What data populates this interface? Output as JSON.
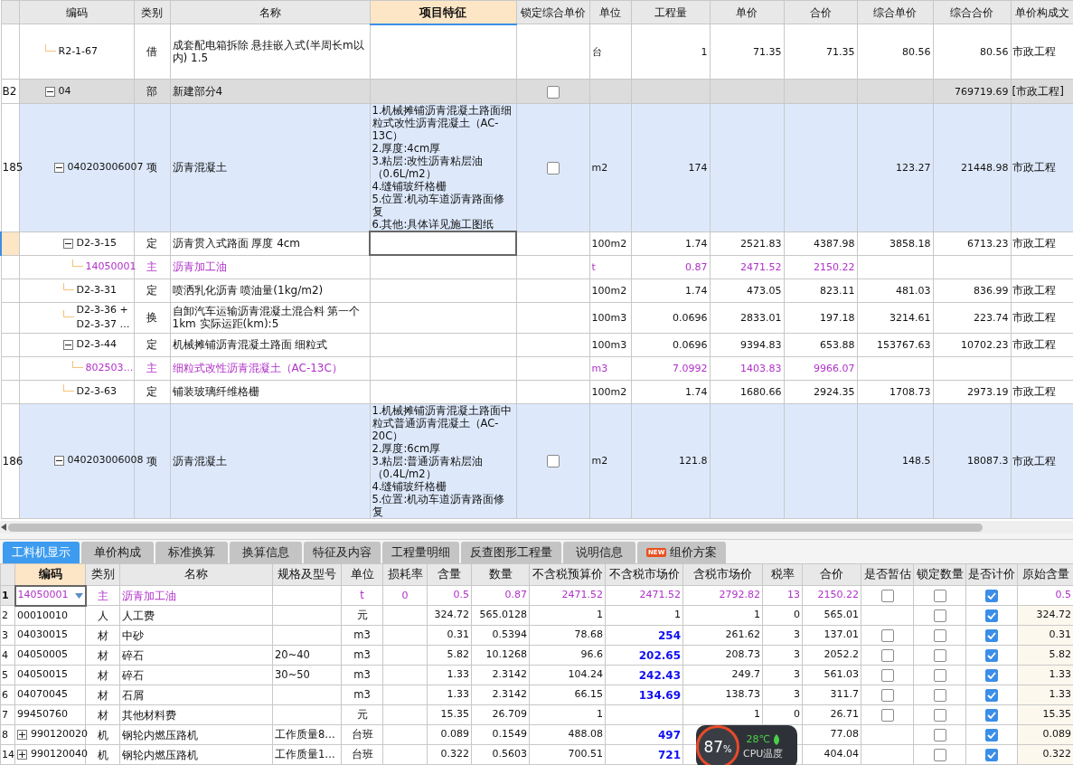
{
  "top_table": {
    "columns": [
      {
        "label": "编码",
        "selected": false
      },
      {
        "label": "类别",
        "selected": false
      },
      {
        "label": "名称",
        "selected": false
      },
      {
        "label": "项目特征",
        "selected": true
      },
      {
        "label": "锁定综合单价",
        "selected": false
      },
      {
        "label": "单位",
        "selected": false
      },
      {
        "label": "工程量",
        "selected": false
      },
      {
        "label": "单价",
        "selected": false
      },
      {
        "label": "合价",
        "selected": false
      },
      {
        "label": "综合单价",
        "selected": false
      },
      {
        "label": "综合合价",
        "selected": false
      },
      {
        "label": "单价构成文",
        "selected": false
      }
    ],
    "rows": [
      {
        "kind": "quota",
        "code": "R2-1-67",
        "type": "借",
        "name": "成套配电箱拆除 悬挂嵌入式(半周长m以内) 1.5",
        "unit": "台",
        "qty": "1",
        "price": "71.35",
        "total": "71.35",
        "unit_total": "80.56",
        "sum_total": "80.56",
        "composition": "市政工程",
        "selected": false
      },
      {
        "kind": "section",
        "num": "B2",
        "code": "04",
        "type": "部",
        "name": "新建部分4",
        "lock": false,
        "sum_total": "769719.69",
        "composition": "[市政工程]",
        "expanded": true,
        "selected": false,
        "children": [
          {
            "kind": "item",
            "num": "185",
            "code": "040203006007",
            "type": "项",
            "name": "沥青混凝土",
            "feature": "1.机械摊铺沥青混凝土路面细粒式改性沥青混凝土（AC-13C）\n2.厚度:4cm厚\n3.粘层:改性沥青粘层油（0.6L/m2）\n4.缝铺玻纤格栅\n5.位置:机动车道沥青路面修复\n6.其他:具体详见施工图纸",
            "lock": false,
            "unit": "m2",
            "qty": "174",
            "unit_total": "123.27",
            "sum_total": "21448.98",
            "composition": "市政工程",
            "expanded": true,
            "selected": false,
            "children": [
              {
                "kind": "quota",
                "code": "D2-3-15",
                "type": "定",
                "name": "沥青贯入式路面 厚度 4cm",
                "unit": "100m2",
                "qty": "1.74",
                "price": "2521.83",
                "total": "4387.98",
                "unit_total": "3858.18",
                "sum_total": "6713.23",
                "composition": "市政工程",
                "expanded": true,
                "selected": true,
                "children": [
                  {
                    "kind": "material",
                    "code": "14050001",
                    "type": "主",
                    "name": "沥青加工油",
                    "unit": "t",
                    "qty": "0.87",
                    "price": "2471.52",
                    "total": "2150.22",
                    "selected": false
                  }
                ]
              },
              {
                "kind": "quota",
                "code": "D2-3-31",
                "type": "定",
                "name": "喷洒乳化沥青 喷油量(1kg/m2)",
                "unit": "100m2",
                "qty": "1.74",
                "price": "473.05",
                "total": "823.11",
                "unit_total": "481.03",
                "sum_total": "836.99",
                "composition": "市政工程",
                "selected": false
              },
              {
                "kind": "quota",
                "code": "D2-3-36 +\nD2-3-37 …",
                "type": "换",
                "name": "自卸汽车运输沥青混凝土混合料 第一个1km  实际运距(km):5",
                "unit": "100m3",
                "qty": "0.0696",
                "price": "2833.01",
                "total": "197.18",
                "unit_total": "3214.61",
                "sum_total": "223.74",
                "composition": "市政工程",
                "selected": false
              },
              {
                "kind": "quota",
                "code": "D2-3-44",
                "type": "定",
                "name": "机械摊铺沥青混凝土路面 细粒式",
                "unit": "100m3",
                "qty": "0.0696",
                "price": "9394.83",
                "total": "653.88",
                "unit_total": "153767.63",
                "sum_total": "10702.23",
                "composition": "市政工程",
                "expanded": true,
                "selected": false,
                "children": [
                  {
                    "kind": "material",
                    "code": "802503…",
                    "type": "主",
                    "name": "细粒式改性沥青混凝土（AC-13C）",
                    "unit": "m3",
                    "qty": "7.0992",
                    "price": "1403.83",
                    "total": "9966.07",
                    "selected": false
                  }
                ]
              },
              {
                "kind": "quota",
                "code": "D2-3-63",
                "type": "定",
                "name": "铺装玻璃纤维格栅",
                "unit": "100m2",
                "qty": "1.74",
                "price": "1680.66",
                "total": "2924.35",
                "unit_total": "1708.73",
                "sum_total": "2973.19",
                "composition": "市政工程",
                "selected": false
              }
            ]
          },
          {
            "kind": "item",
            "num": "186",
            "code": "040203006008",
            "type": "项",
            "name": "沥青混凝土",
            "feature": "1.机械摊铺沥青混凝土路面中粒式普通沥青混凝土（AC-20C）\n2.厚度:6cm厚\n3.粘层:普通沥青粘层油（0.4L/m2）\n4.缝铺玻纤格栅\n5.位置:机动车道沥青路面修复",
            "lock": false,
            "unit": "m2",
            "qty": "121.8",
            "unit_total": "148.5",
            "sum_total": "18087.3",
            "composition": "市政工程",
            "expanded": true,
            "selected": false
          }
        ]
      }
    ]
  },
  "tabs": [
    {
      "label": "工料机显示",
      "selected": true
    },
    {
      "label": "单价构成",
      "selected": false
    },
    {
      "label": "标准换算",
      "selected": false
    },
    {
      "label": "换算信息",
      "selected": false
    },
    {
      "label": "特征及内容",
      "selected": false
    },
    {
      "label": "工程量明细",
      "selected": false
    },
    {
      "label": "反查图形工程量",
      "selected": false
    },
    {
      "label": "说明信息",
      "selected": false
    },
    {
      "label": "组价方案",
      "badge": "NEW",
      "selected": false
    }
  ],
  "bottom_table": {
    "columns": [
      {
        "label": "编码",
        "selected": true
      },
      {
        "label": "类别",
        "selected": false
      },
      {
        "label": "名称",
        "selected": false
      },
      {
        "label": "规格及型号",
        "selected": false
      },
      {
        "label": "单位",
        "selected": false
      },
      {
        "label": "损耗率",
        "selected": false
      },
      {
        "label": "含量",
        "selected": false
      },
      {
        "label": "数量",
        "selected": false
      },
      {
        "label": "不含税预算价",
        "selected": false
      },
      {
        "label": "不含税市场价",
        "selected": false
      },
      {
        "label": "含税市场价",
        "selected": false
      },
      {
        "label": "税率",
        "selected": false
      },
      {
        "label": "合价",
        "selected": false
      },
      {
        "label": "是否暂估",
        "selected": false
      },
      {
        "label": "锁定数量",
        "selected": false
      },
      {
        "label": "是否计价",
        "selected": false
      },
      {
        "label": "原始含量",
        "selected": false
      }
    ],
    "rows": [
      {
        "num": "1",
        "kind": "main",
        "code": "14050001",
        "type": "主",
        "name": "沥青加工油",
        "unit": "t",
        "loss": "0",
        "content": "0.5",
        "qty": "0.87",
        "budget": "2471.52",
        "market": "2471.52",
        "market_adjusted": false,
        "market_tax": "2792.82",
        "tax": "13",
        "total": "2150.22",
        "provisional": false,
        "lock_qty": false,
        "priced": true,
        "original": "0.5",
        "selected": true
      },
      {
        "num": "2",
        "kind": "normal",
        "code": "00010010",
        "type": "人",
        "name": "人工费",
        "unit": "元",
        "content": "324.72",
        "qty": "565.0128",
        "budget": "1",
        "market": "1",
        "market_adjusted": false,
        "market_tax": "1",
        "tax": "0",
        "total": "565.01",
        "lock_qty": false,
        "priced": true,
        "original": "324.72",
        "selected": false
      },
      {
        "num": "3",
        "kind": "normal",
        "code": "04030015",
        "type": "材",
        "name": "中砂",
        "unit": "m3",
        "content": "0.31",
        "qty": "0.5394",
        "budget": "78.68",
        "market": "254",
        "market_adjusted": true,
        "market_tax": "261.62",
        "tax": "3",
        "total": "137.01",
        "provisional": false,
        "lock_qty": false,
        "priced": true,
        "original": "0.31",
        "selected": false
      },
      {
        "num": "4",
        "kind": "normal",
        "code": "04050005",
        "type": "材",
        "name": "碎石",
        "spec": "20~40",
        "unit": "m3",
        "content": "5.82",
        "qty": "10.1268",
        "budget": "96.6",
        "market": "202.65",
        "market_adjusted": true,
        "market_tax": "208.73",
        "tax": "3",
        "total": "2052.2",
        "provisional": false,
        "lock_qty": false,
        "priced": true,
        "original": "5.82",
        "selected": false
      },
      {
        "num": "5",
        "kind": "normal",
        "code": "04050015",
        "type": "材",
        "name": "碎石",
        "spec": "30~50",
        "unit": "m3",
        "content": "1.33",
        "qty": "2.3142",
        "budget": "104.24",
        "market": "242.43",
        "market_adjusted": true,
        "market_tax": "249.7",
        "tax": "3",
        "total": "561.03",
        "provisional": false,
        "lock_qty": false,
        "priced": true,
        "original": "1.33",
        "selected": false
      },
      {
        "num": "6",
        "kind": "normal",
        "code": "04070045",
        "type": "材",
        "name": "石屑",
        "unit": "m3",
        "content": "1.33",
        "qty": "2.3142",
        "budget": "66.15",
        "market": "134.69",
        "market_adjusted": true,
        "market_tax": "138.73",
        "tax": "3",
        "total": "311.7",
        "provisional": false,
        "lock_qty": false,
        "priced": true,
        "original": "1.33",
        "selected": false
      },
      {
        "num": "7",
        "kind": "normal",
        "code": "99450760",
        "type": "材",
        "name": "其他材料费",
        "unit": "元",
        "content": "15.35",
        "qty": "26.709",
        "budget": "1",
        "market_tax": "1",
        "tax": "0",
        "total": "26.71",
        "provisional": false,
        "lock_qty": false,
        "priced": true,
        "original": "15.35",
        "selected": false
      },
      {
        "num": "8",
        "kind": "normal",
        "expanded": false,
        "code": "990120020",
        "type": "机",
        "name": "钢轮内燃压路机",
        "spec": "工作质量8…",
        "unit": "台班",
        "content": "0.089",
        "qty": "0.1549",
        "budget": "488.08",
        "market": "497",
        "market_adjusted": true,
        "total": "77.08",
        "lock_qty": false,
        "priced": true,
        "original": "0.089",
        "selected": false
      },
      {
        "num": "14",
        "kind": "normal",
        "expanded": false,
        "code": "990120040",
        "type": "机",
        "name": "钢轮内燃压路机",
        "spec": "工作质量1…",
        "unit": "台班",
        "content": "0.322",
        "qty": "0.5603",
        "budget": "700.51",
        "market": "721",
        "market_adjusted": true,
        "total": "404.04",
        "lock_qty": false,
        "priced": true,
        "original": "0.322",
        "selected": false
      }
    ]
  },
  "cpu_widget": {
    "percent": "87",
    "unit": "%",
    "temperature": "28℃",
    "label": "CPU温度"
  }
}
